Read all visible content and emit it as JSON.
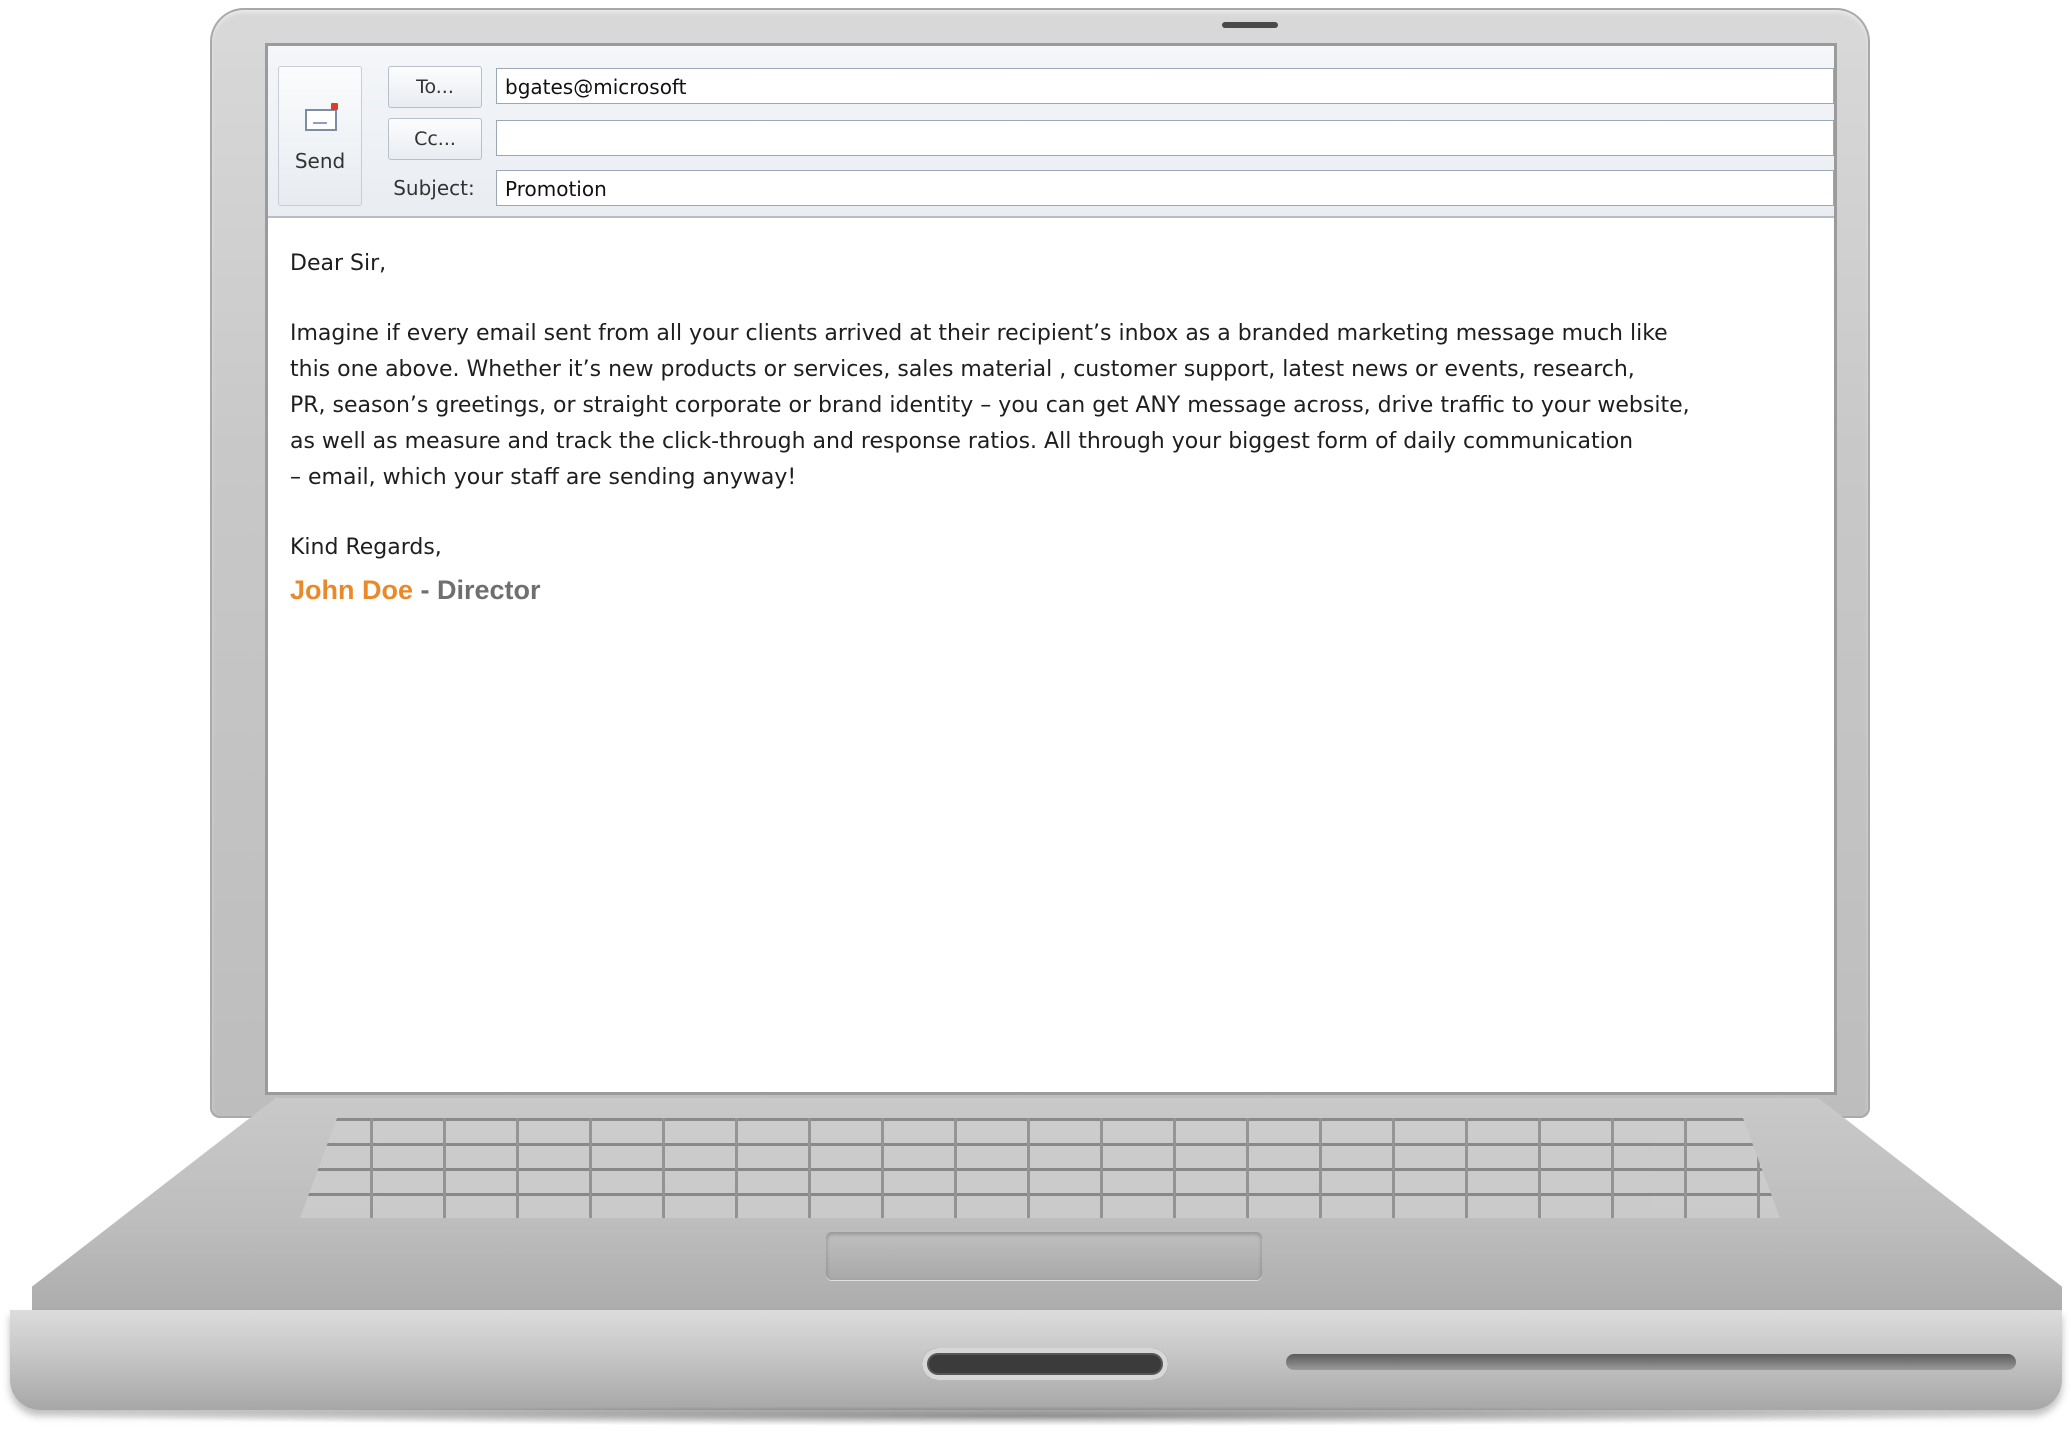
{
  "compose": {
    "send_label": "Send",
    "to_button": "To...",
    "cc_button": "Cc...",
    "subject_label": "Subject:",
    "to_value": "bgates@microsoft",
    "cc_value": "",
    "subject_value": "Promotion"
  },
  "message": {
    "greeting": "Dear Sir,",
    "lines": [
      "Imagine if every email sent from all your clients arrived at their recipient’s inbox as a branded marketing message much like",
      "this one above. Whether it’s new products or services, sales material , customer support, latest news or events, research,",
      "PR, season’s greetings, or straight corporate or brand identity – you can get ANY message across, drive traffic to your website,",
      "as well as measure and track the click-through and response ratios. All through your biggest form of daily communication",
      "– email, which your staff are sending anyway!"
    ],
    "closing": "Kind Regards,",
    "signature_name": "John Doe",
    "signature_role": " - Director"
  },
  "icons": {
    "send": "envelope-icon"
  },
  "colors": {
    "signature_name": "#e98a2a",
    "signature_role": "#6f6f6f"
  }
}
